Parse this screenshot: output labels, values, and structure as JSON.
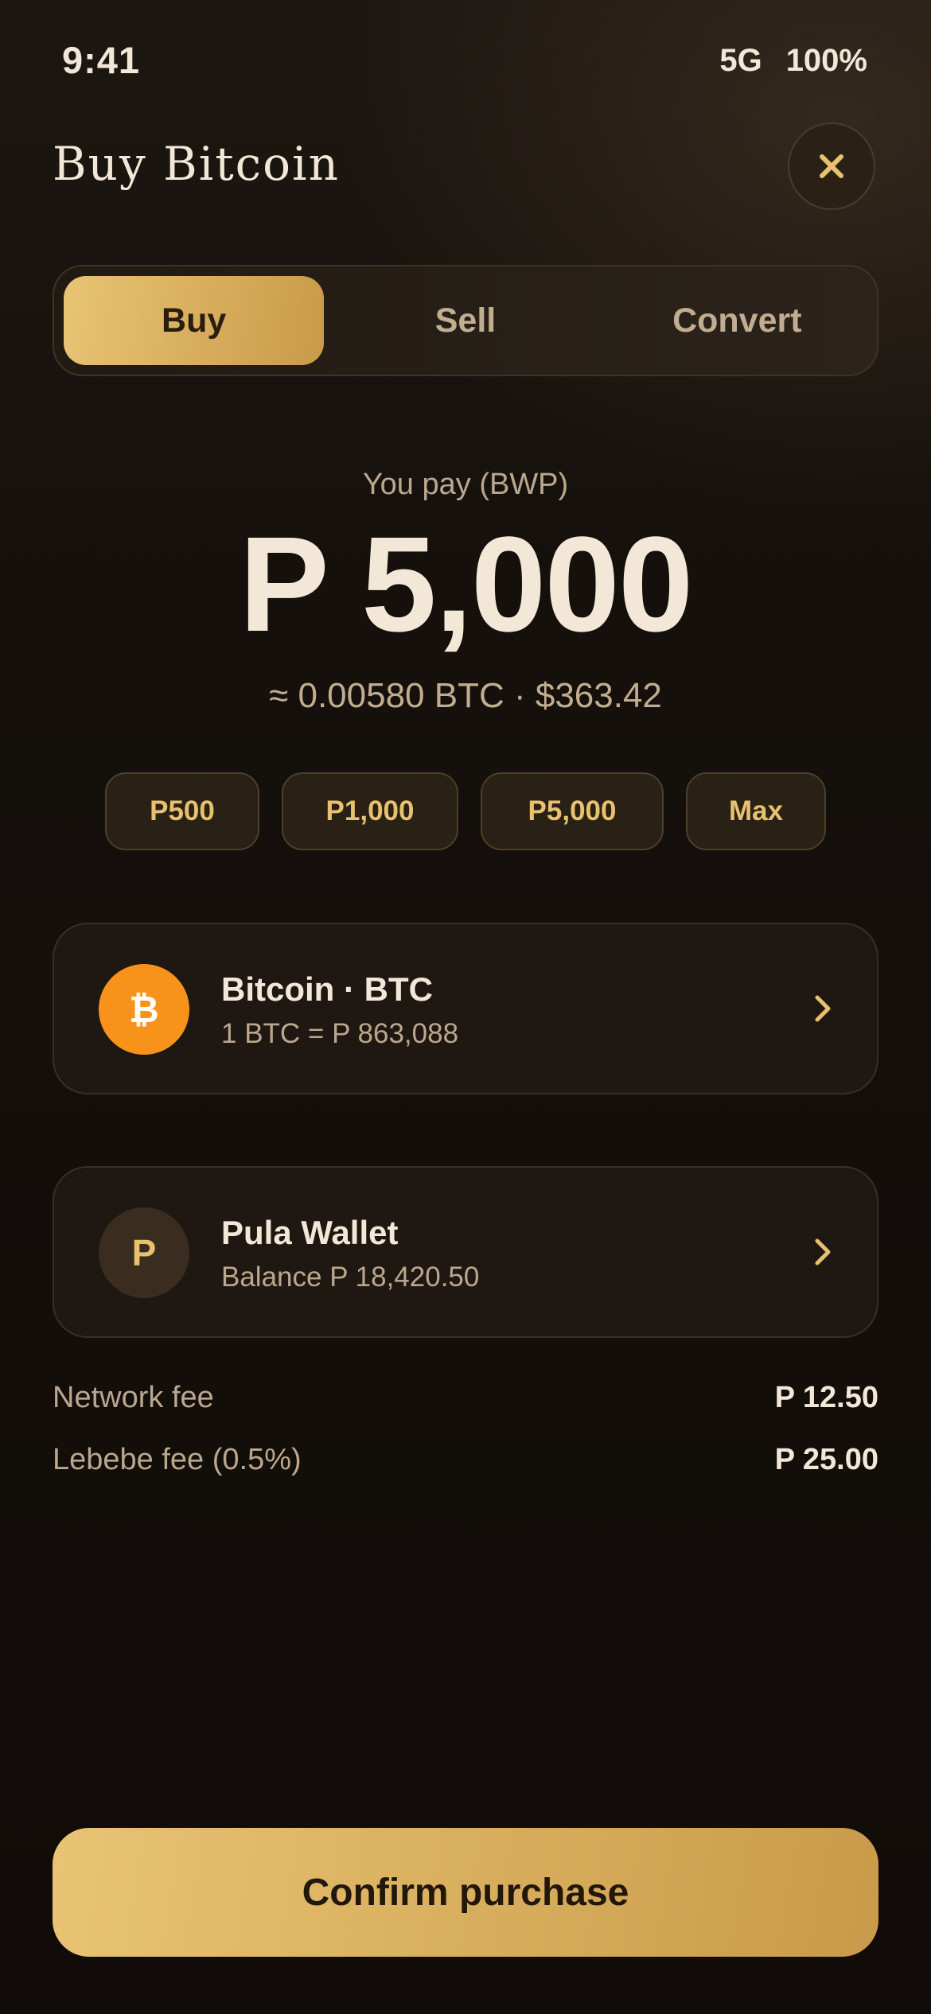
{
  "status_bar": {
    "time": "9:41",
    "network": "5G",
    "battery": "100%"
  },
  "header": {
    "title": "Buy Bitcoin",
    "close_icon": "close-icon"
  },
  "tabs": [
    {
      "label": "Buy",
      "active": true
    },
    {
      "label": "Sell",
      "active": false
    },
    {
      "label": "Convert",
      "active": false
    }
  ],
  "amount": {
    "label": "You pay (BWP)",
    "value": "P 5,000",
    "equivalent": "≈ 0.00580 BTC · $363.42"
  },
  "quick_amounts": [
    "P500",
    "P1,000",
    "P5,000",
    "Max"
  ],
  "asset_card": {
    "icon_glyph": "₿",
    "title": "Bitcoin · BTC",
    "rate": "1 BTC = P 863,088"
  },
  "wallet_card": {
    "icon_glyph": "P",
    "title": "Pula Wallet",
    "balance": "Balance P 18,420.50"
  },
  "fees": [
    {
      "label": "Network fee",
      "value": "P 12.50"
    },
    {
      "label": "Lebebe fee (0.5%)",
      "value": "P 25.00"
    }
  ],
  "confirm_label": "Confirm purchase",
  "colors": {
    "accent_gold": "#e8c474",
    "accent_gold_dark": "#c99a49",
    "bitcoin_orange": "#f7931a",
    "background": "#130d09",
    "text_primary": "#f3e8d8",
    "text_muted": "#bba78d"
  }
}
